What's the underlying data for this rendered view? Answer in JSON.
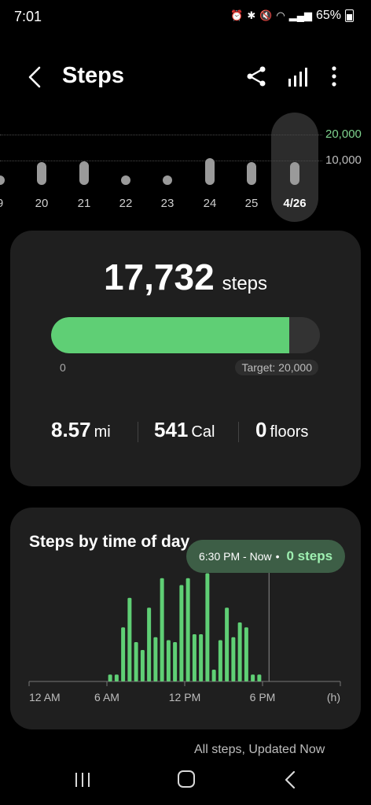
{
  "status": {
    "time": "7:01",
    "icons": [
      "alarm-icon",
      "bluetooth-icon",
      "mute-icon",
      "wifi-icon",
      "signal-icon"
    ],
    "battery": "65%"
  },
  "header": {
    "title": "Steps"
  },
  "week": {
    "scale_labels": [
      "20,000",
      "10,000"
    ],
    "scale_max": 20000,
    "days": [
      {
        "label": "9",
        "steps": 1000
      },
      {
        "label": "20",
        "steps": 9000
      },
      {
        "label": "21",
        "steps": 9500
      },
      {
        "label": "22",
        "steps": 600
      },
      {
        "label": "23",
        "steps": 600
      },
      {
        "label": "24",
        "steps": 10500
      },
      {
        "label": "25",
        "steps": 9000
      },
      {
        "label": "4/26",
        "steps": 9000,
        "selected": true
      }
    ]
  },
  "summary": {
    "steps": "17,732",
    "steps_unit": "steps",
    "progress_value": 17732,
    "target": 20000,
    "progress_min": "0",
    "target_label": "Target: 20,000",
    "distance_value": "8.57",
    "distance_unit": "mi",
    "calories_value": "541",
    "calories_unit": "Cal",
    "floors_value": "0",
    "floors_unit": "floors"
  },
  "time_of_day": {
    "title": "Steps by time of day",
    "tooltip_time": "6:30 PM - Now",
    "tooltip_steps": "0 steps",
    "chart_data": {
      "type": "bar",
      "title": "Steps by time of day",
      "xlabel": "(h)",
      "x_ticks": [
        "12 AM",
        "6 AM",
        "12 PM",
        "6 PM"
      ],
      "x_range": [
        0,
        24
      ],
      "y_max": 100,
      "interval_minutes": 30,
      "start_hour": 6,
      "values": [
        7,
        7,
        55,
        85,
        40,
        32,
        75,
        45,
        105,
        42,
        40,
        98,
        105,
        48,
        48,
        110,
        12,
        42,
        75,
        45,
        60,
        55,
        7,
        7
      ],
      "marker_hour": 18.5,
      "bar_color": "#5fcf75"
    }
  },
  "footer": {
    "note": "All steps, Updated Now"
  }
}
